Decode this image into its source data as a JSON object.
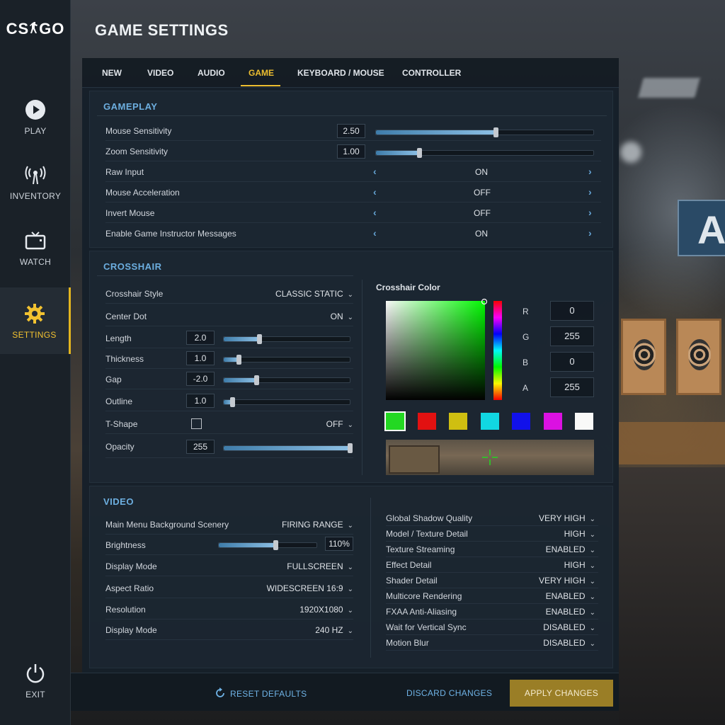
{
  "app": {
    "logo": "CS GO",
    "title": "GAME SETTINGS"
  },
  "sidebar": {
    "items": [
      {
        "label": "PLAY",
        "icon": "play-icon"
      },
      {
        "label": "INVENTORY",
        "icon": "antenna-icon"
      },
      {
        "label": "WATCH",
        "icon": "tv-icon"
      },
      {
        "label": "SETTINGS",
        "icon": "gear-icon",
        "active": true
      },
      {
        "label": "EXIT",
        "icon": "power-icon"
      }
    ]
  },
  "tabs": [
    "NEW",
    "VIDEO",
    "AUDIO",
    "GAME",
    "KEYBOARD / MOUSE",
    "CONTROLLER"
  ],
  "active_tab": "GAME",
  "gameplay": {
    "title": "GAMEPLAY",
    "mouse_sensitivity": {
      "label": "Mouse Sensitivity",
      "value": "2.50",
      "level": 0.55
    },
    "zoom_sensitivity": {
      "label": "Zoom Sensitivity",
      "value": "1.00",
      "level": 0.2
    },
    "toggles": [
      {
        "label": "Raw Input",
        "value": "ON"
      },
      {
        "label": "Mouse Acceleration",
        "value": "OFF"
      },
      {
        "label": "Invert Mouse",
        "value": "OFF"
      },
      {
        "label": "Enable Game Instructor Messages",
        "value": "ON"
      }
    ]
  },
  "crosshair": {
    "title": "CROSSHAIR",
    "style": {
      "label": "Crosshair Style",
      "value": "CLASSIC STATIC"
    },
    "center_dot": {
      "label": "Center Dot",
      "value": "ON"
    },
    "length": {
      "label": "Length",
      "value": "2.0",
      "level": 0.28
    },
    "thickness": {
      "label": "Thickness",
      "value": "1.0",
      "level": 0.12
    },
    "gap": {
      "label": "Gap",
      "value": "-2.0",
      "level": 0.26
    },
    "outline": {
      "label": "Outline",
      "value": "1.0",
      "level": 0.07
    },
    "tshape": {
      "label": "T-Shape",
      "value": "OFF"
    },
    "opacity": {
      "label": "Opacity",
      "value": "255",
      "level": 1.0
    },
    "color": {
      "title": "Crosshair Color",
      "r_label": "R",
      "r": "0",
      "g_label": "G",
      "g": "255",
      "b_label": "B",
      "b": "0",
      "a_label": "A",
      "a": "255",
      "swatches": [
        "#22dd22",
        "#e81010",
        "#d4c410",
        "#10dce8",
        "#1010f0",
        "#e010e8",
        "#ffffff"
      ]
    }
  },
  "video": {
    "title": "VIDEO",
    "left": [
      {
        "label": "Main Menu Background Scenery",
        "value": "FIRING RANGE"
      },
      {
        "label": "Brightness",
        "value": "110%",
        "level": 0.58
      },
      {
        "label": "Display Mode",
        "value": "FULLSCREEN"
      },
      {
        "label": "Aspect Ratio",
        "value": "WIDESCREEN 16:9"
      },
      {
        "label": "Resolution",
        "value": "1920X1080"
      },
      {
        "label": "Display Mode",
        "value": "240 HZ"
      }
    ],
    "right": [
      {
        "label": "Global Shadow Quality",
        "value": "VERY HIGH"
      },
      {
        "label": "Model / Texture Detail",
        "value": "HIGH"
      },
      {
        "label": "Texture Streaming",
        "value": "ENABLED"
      },
      {
        "label": "Effect Detail",
        "value": "HIGH"
      },
      {
        "label": "Shader Detail",
        "value": "VERY HIGH"
      },
      {
        "label": "Multicore Rendering",
        "value": "ENABLED"
      },
      {
        "label": "FXAA Anti-Aliasing",
        "value": "ENABLED"
      },
      {
        "label": "Wait for Vertical Sync",
        "value": "DISABLED"
      },
      {
        "label": "Motion Blur",
        "value": "DISABLED"
      }
    ]
  },
  "footer": {
    "reset": "RESET DEFAULTS",
    "discard": "DISCARD CHANGES",
    "apply": "APPLY CHANGES"
  },
  "colors": {
    "accent": "#f2c230",
    "section_title": "#6fb3e6",
    "apply_bg": "#9a7e26"
  }
}
